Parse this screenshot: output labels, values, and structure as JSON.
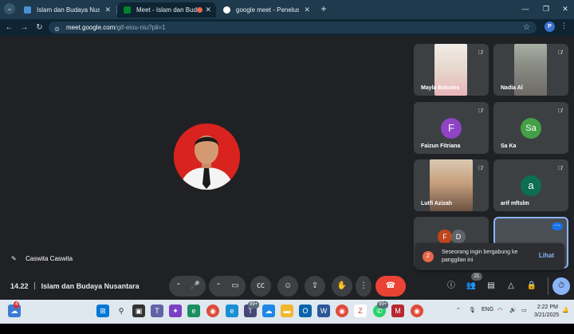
{
  "browser": {
    "tabs": [
      {
        "title": "Islam dan Budaya Nusantara",
        "close": "✕"
      },
      {
        "title": "Meet - Islam dan Budaya N",
        "close": "✕"
      },
      {
        "title": "google meet - Penelusuran Go",
        "close": "✕"
      }
    ],
    "new_tab": "+",
    "window_controls": {
      "minimize": "—",
      "restore": "❐",
      "close": "✕"
    },
    "url_host": "meet.google.com",
    "url_path": "/gif-eiou-niu?pli=1",
    "profile_initial": "P"
  },
  "meet": {
    "main_participant": "Caswita Caswita",
    "tiles": [
      {
        "name": "Mayla Bakoles",
        "type": "photo"
      },
      {
        "name": "Nadia Al",
        "type": "photo"
      },
      {
        "name": "Faizun Fitriana",
        "letter": "F",
        "color": "#8e44c4"
      },
      {
        "name": "Sa Ka",
        "letter": "Sa",
        "color": "#43a047"
      },
      {
        "name": "Lutfi Azizah",
        "type": "photo"
      },
      {
        "name": "arif mftslm",
        "letter": "a",
        "color": "#0d6f4f"
      }
    ],
    "mini_avatars": [
      {
        "letter": "F",
        "color": "#c2451d"
      },
      {
        "letter": "D",
        "color": "#5f6368"
      }
    ],
    "notification": {
      "avatar": "Z",
      "text": "Seseorang ingin bergabung ke panggilan ini",
      "action": "Lihat"
    },
    "time": "14.22",
    "meeting_title": "Islam dan Budaya Nusantara",
    "participant_count": "21"
  },
  "taskbar": {
    "mail_badge": "4",
    "teams_badge": "99+",
    "whatsapp_badge": "99+",
    "lang": "ENG",
    "time": "2:22 PM",
    "date": "3/21/2025"
  },
  "colors": {
    "meet_bg": "#202124",
    "end_call": "#ea4335",
    "accent": "#8ab4f8"
  }
}
